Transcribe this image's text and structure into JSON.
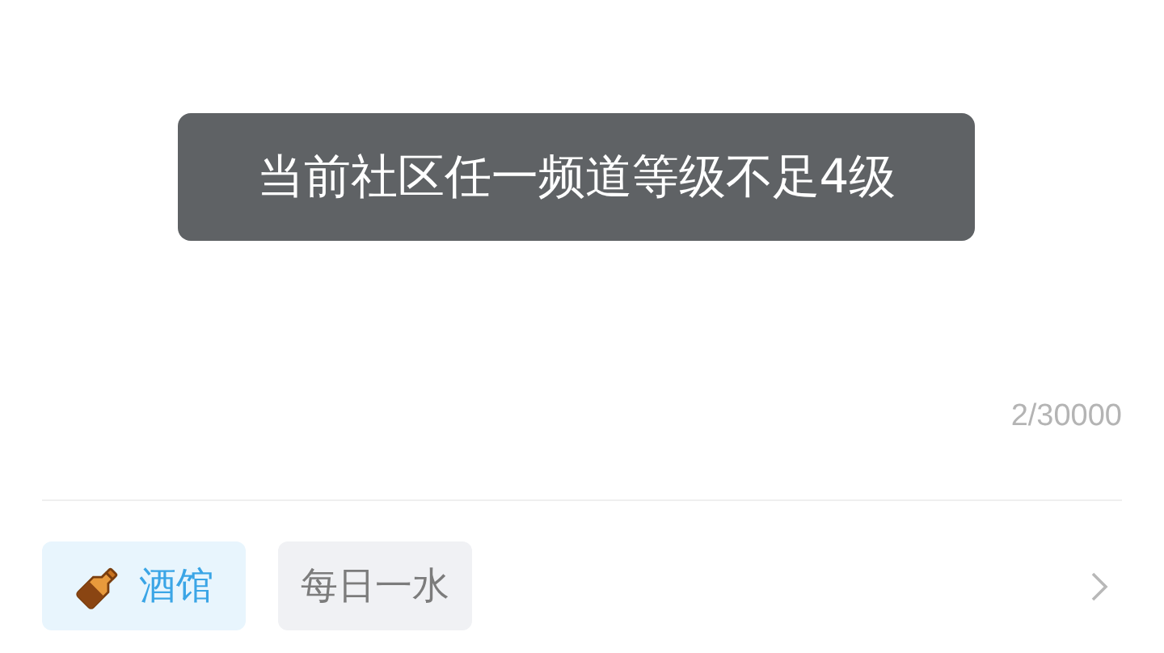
{
  "toast": {
    "message": "当前社区任一频道等级不足4级"
  },
  "counter": "2/30000",
  "tags": [
    {
      "label": "酒馆",
      "kind": "channel",
      "selected": true
    },
    {
      "label": "每日一水",
      "kind": "plain",
      "selected": false
    }
  ]
}
